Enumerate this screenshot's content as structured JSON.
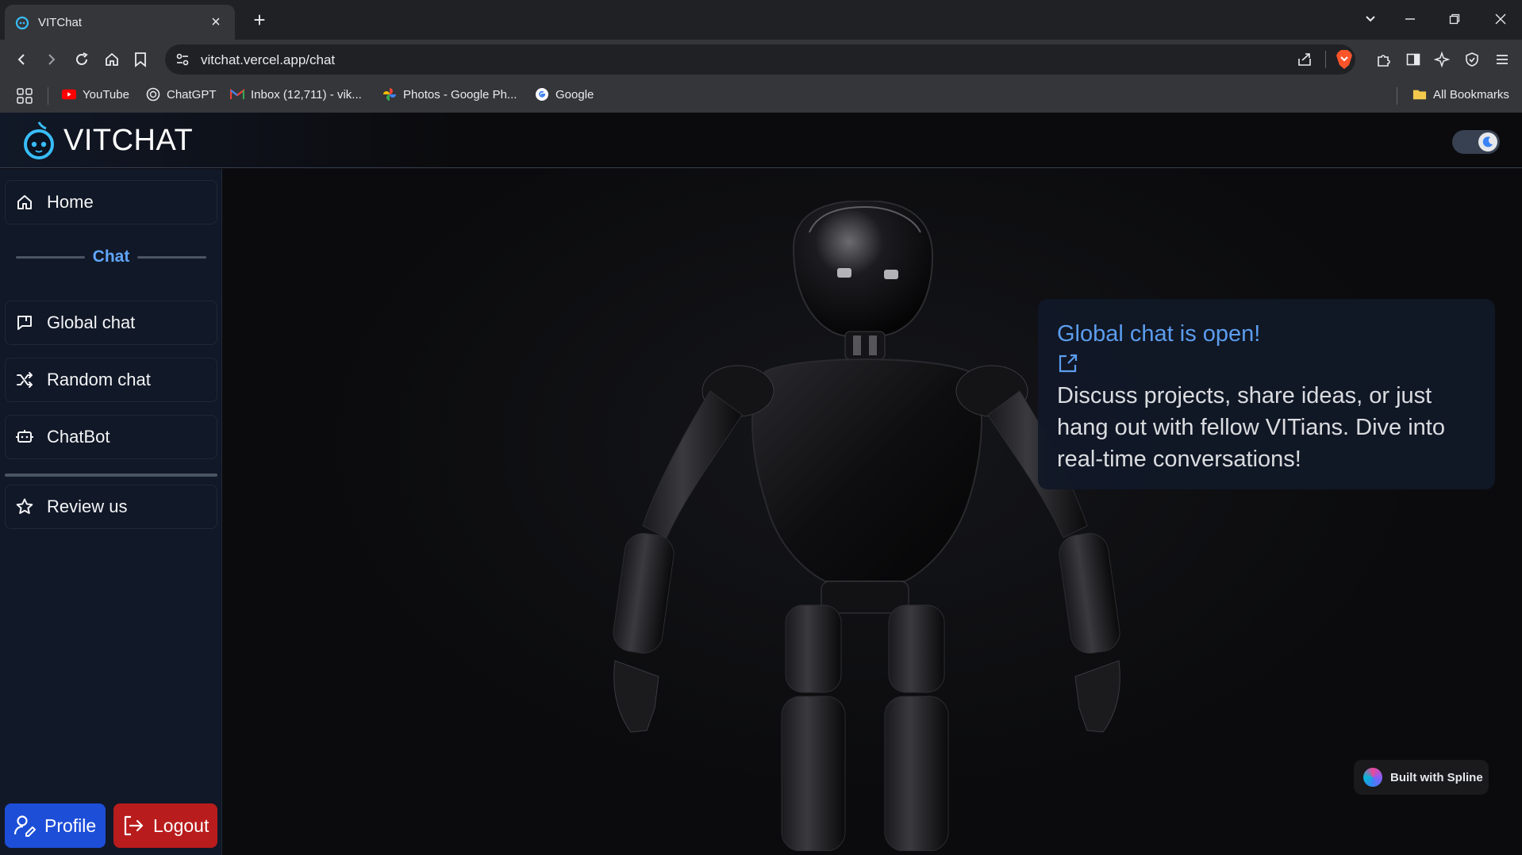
{
  "browser": {
    "tab_title": "VITChat",
    "url": "vitchat.vercel.app/chat",
    "bookmarks": [
      {
        "label": "YouTube",
        "icon": "youtube-icon"
      },
      {
        "label": "ChatGPT",
        "icon": "chatgpt-icon"
      },
      {
        "label": "Inbox (12,711) - vik...",
        "icon": "gmail-icon"
      },
      {
        "label": "Photos - Google Ph...",
        "icon": "google-photos-icon"
      },
      {
        "label": "Google",
        "icon": "google-icon"
      }
    ],
    "all_bookmarks": "All Bookmarks"
  },
  "app": {
    "brand": "VITCHAT",
    "accent_color": "#60a5fa",
    "sidebar": {
      "home": "Home",
      "section_chat": "Chat",
      "items": [
        {
          "label": "Global chat",
          "icon": "chat-bubble-icon"
        },
        {
          "label": "Random chat",
          "icon": "shuffle-icon"
        },
        {
          "label": "ChatBot",
          "icon": "bot-icon"
        }
      ],
      "review": "Review us",
      "profile": "Profile",
      "logout": "Logout"
    },
    "card": {
      "headline": "Global chat is open!",
      "body": "Discuss projects, share ideas, or just hang out with fellow VITians. Dive into real-time conversations!"
    },
    "spline_badge": "Built with Spline"
  }
}
